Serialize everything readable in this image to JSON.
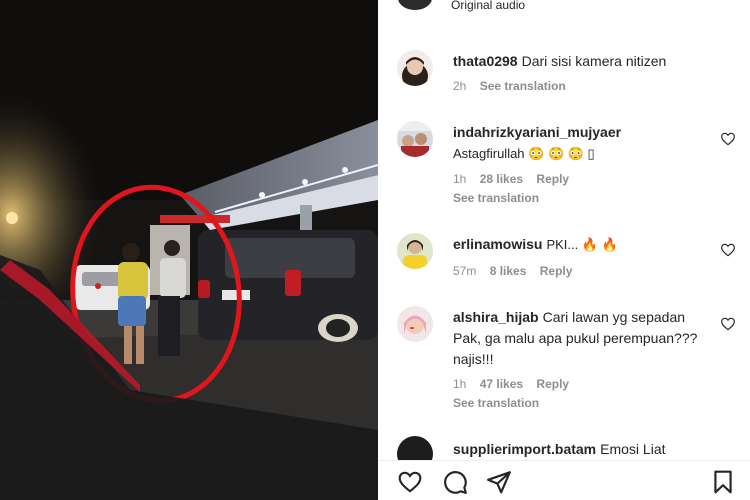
{
  "post": {
    "audio_label": "Original audio"
  },
  "comments": [
    {
      "username": "thata0298",
      "text": "Dari sisi kamera nitizen",
      "time": "2h",
      "likes": "",
      "reply": "",
      "see_translation": "See translation",
      "show_heart": false
    },
    {
      "username": "indahrizkyariani_mujyaer",
      "text": "Astagfirullah 😳 😳 😳 ▯",
      "time": "1h",
      "likes": "28 likes",
      "reply": "Reply",
      "see_translation": "See translation",
      "show_heart": true
    },
    {
      "username": "erlinamowisu",
      "text": "PKI... 🔥 🔥",
      "time": "57m",
      "likes": "8 likes",
      "reply": "Reply",
      "see_translation": "",
      "show_heart": true
    },
    {
      "username": "alshira_hijab",
      "text": "Cari lawan yg sepadan Pak, ga malu apa pukul perempuan??? najis!!!",
      "time": "1h",
      "likes": "47 likes",
      "reply": "Reply",
      "see_translation": "See translation",
      "show_heart": true
    },
    {
      "username": "supplierimport.batam",
      "text": "Emosi Liat",
      "time": "",
      "likes": "",
      "reply": "",
      "see_translation": "",
      "show_heart": false
    }
  ],
  "actions": [
    {
      "icon": "heart-icon"
    },
    {
      "icon": "comment-icon"
    },
    {
      "icon": "share-icon"
    },
    {
      "icon": "bookmark-icon"
    }
  ],
  "colors": {
    "text": "#262626",
    "muted": "#8e8e8e",
    "highlight_circle": "#e0161c"
  }
}
